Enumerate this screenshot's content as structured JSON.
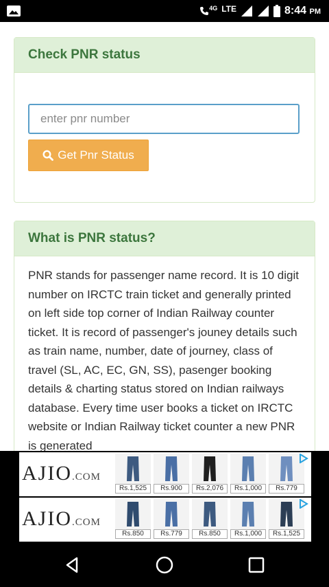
{
  "status_bar": {
    "network": "4G",
    "lte": "LTE",
    "time": "8:44",
    "ampm": "PM"
  },
  "pnr_card": {
    "title": "Check PNR status",
    "input_placeholder": "enter pnr number",
    "input_value": "",
    "button_label": "Get Pnr Status"
  },
  "info_card": {
    "title": "What is PNR status?",
    "body": "PNR stands for passenger name record. It is 10 digit number on IRCTC train ticket and generally printed on left side top corner of Indian Railway counter ticket. It is record of passenger's jouney details such as train name, number, date of journey, class of travel (SL, AC, EC, GN, SS), pasenger booking details & charting status stored on Indian railways database. Every time user books a ticket on IRCTC website or Indian Railway ticket counter a new PNR is generated"
  },
  "ads": [
    {
      "brand": "AJIO",
      "brand_suffix": ".COM",
      "prices": [
        "Rs.1,525",
        "Rs.900",
        "Rs.2,076",
        "Rs.1,000",
        "Rs.779"
      ]
    },
    {
      "brand": "AJIO",
      "brand_suffix": ".COM",
      "prices": [
        "Rs.850",
        "Rs.779",
        "Rs.850",
        "Rs.1,000",
        "Rs.1,525"
      ]
    }
  ],
  "colors": {
    "accent_green": "#3c763d",
    "panel_header_bg": "#dff0d8",
    "button_orange": "#f0ad4e",
    "input_border": "#5a9fc9"
  },
  "icons": {
    "status_left": "image-icon",
    "button": "search-icon",
    "nav": [
      "back-icon",
      "home-icon",
      "recents-icon"
    ]
  }
}
